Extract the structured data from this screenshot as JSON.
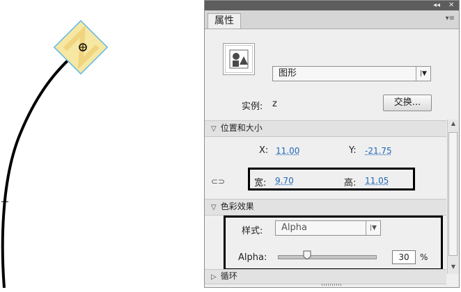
{
  "panel": {
    "title_controls": {
      "collapse": "◂◂",
      "close": "✕"
    },
    "tab_label": "属性",
    "symbol_type": "图形",
    "instance_label": "实例:",
    "instance_name": "z",
    "swap_button": "交换...",
    "position_section": "位置和大小",
    "x_label": "X:",
    "x_value": "11.00",
    "y_label": "Y:",
    "y_value": "-21.75",
    "width_label": "宽:",
    "width_value": "9.70",
    "height_label": "高:",
    "height_value": "11.05",
    "color_section": "色彩效果",
    "style_label": "样式:",
    "style_value": "Alpha",
    "alpha_label": "Alpha:",
    "alpha_value": "30",
    "alpha_unit": "%",
    "loop_section": "循环"
  },
  "colors": {
    "highlight_border": "#000000",
    "value_link": "#1f66b8",
    "symbol_fill": "#f6e7a3",
    "symbol_outline": "#5fb8e6"
  },
  "icons": [
    "link-width-height-icon",
    "panel-menu-icon",
    "graphic-symbol-icon",
    "dropdown-arrow-icon",
    "section-collapse-icon"
  ]
}
